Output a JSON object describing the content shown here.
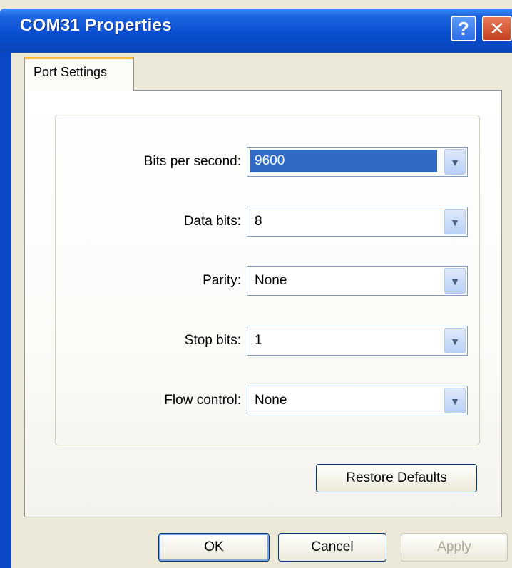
{
  "window": {
    "title": "COM31 Properties"
  },
  "titlebar": {
    "help_glyph": "?",
    "close_glyph": "✕"
  },
  "tabs": [
    {
      "label": "Port Settings",
      "active": true
    }
  ],
  "settings": [
    {
      "label": "Bits per second:",
      "value": "9600",
      "selected": true
    },
    {
      "label": "Data bits:",
      "value": "8",
      "selected": false
    },
    {
      "label": "Parity:",
      "value": "None",
      "selected": false
    },
    {
      "label": "Stop bits:",
      "value": "1",
      "selected": false
    },
    {
      "label": "Flow control:",
      "value": "None",
      "selected": false
    }
  ],
  "restore_defaults_label": "Restore Defaults",
  "footer": {
    "ok_label": "OK",
    "cancel_label": "Cancel",
    "apply_label": "Apply",
    "apply_disabled": true
  },
  "icons": {
    "dropdown_arrow": "chevron-down-icon",
    "help": "help-icon",
    "close": "close-icon"
  },
  "colors": {
    "titlebar": "#0a4fd1",
    "selection": "#316ac5",
    "tab_accent": "#f4b43a",
    "face": "#ece9d8"
  }
}
